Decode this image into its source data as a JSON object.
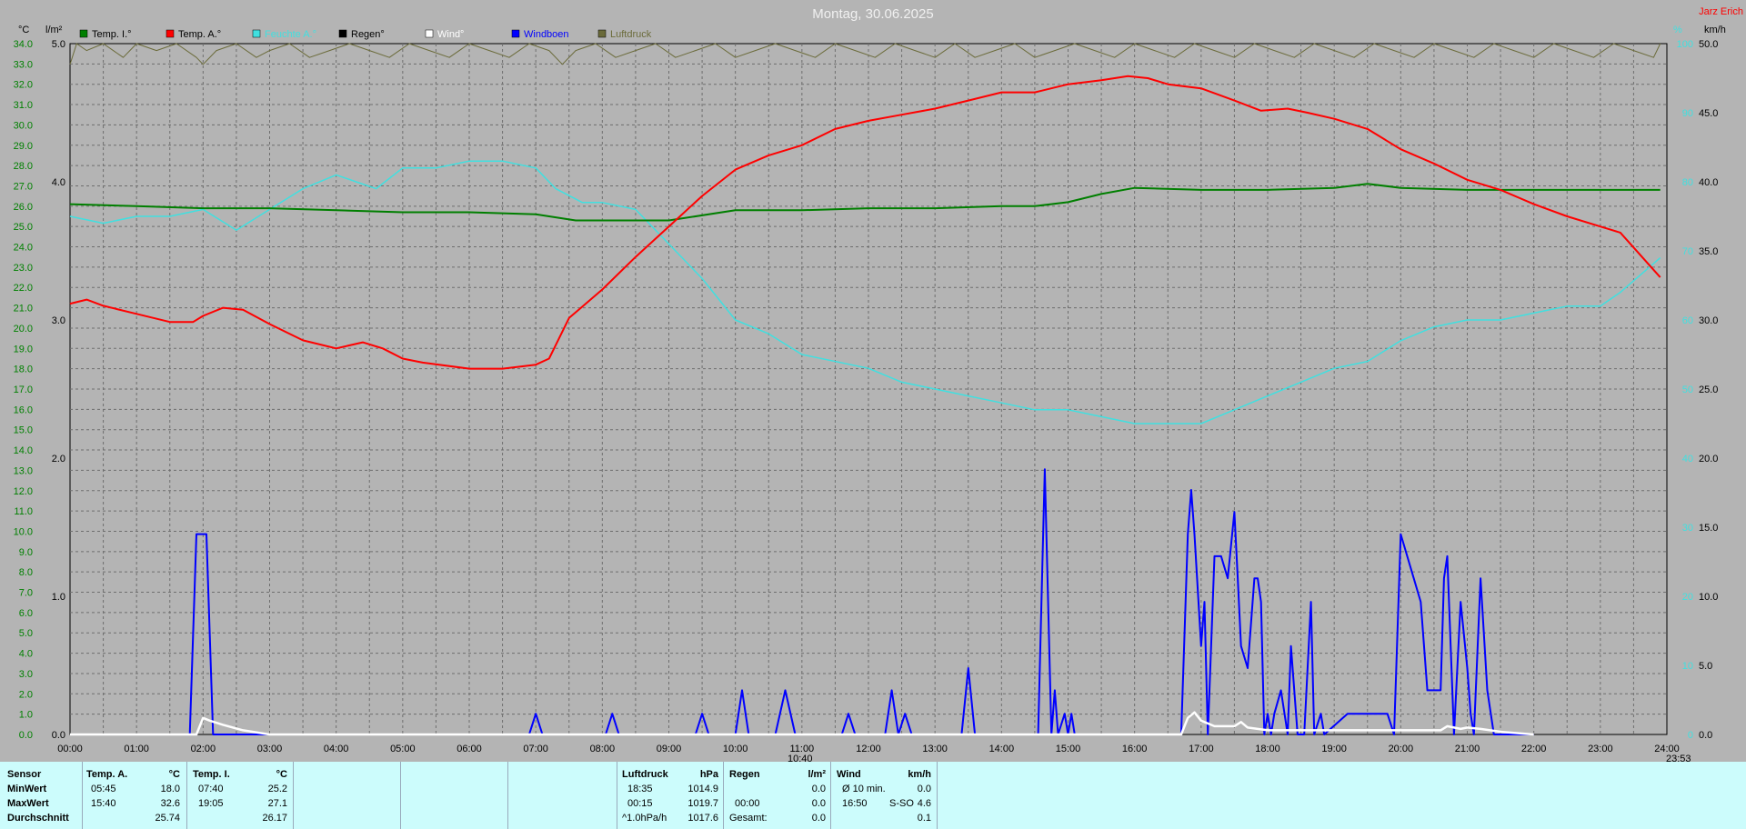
{
  "header": {
    "title": "Montag, 30.06.2025",
    "author": "Jarz Erich",
    "unit_left_temp": "°C",
    "unit_left_rain": "l/m²",
    "unit_right_a": "%",
    "unit_right_b": "km/h"
  },
  "markers": {
    "sunrise": "10:40",
    "sunset": "23:53"
  },
  "chart_data": {
    "type": "line",
    "x_ticks": [
      "00:00",
      "01:00",
      "02:00",
      "03:00",
      "04:00",
      "05:00",
      "06:00",
      "07:00",
      "08:00",
      "09:00",
      "10:00",
      "11:00",
      "12:00",
      "13:00",
      "14:00",
      "15:00",
      "16:00",
      "17:00",
      "18:00",
      "19:00",
      "20:00",
      "21:00",
      "22:00",
      "23:00",
      "24:00"
    ],
    "axes": {
      "temp": {
        "min": 0,
        "max": 34,
        "ticks": [
          "0.0",
          "1.0",
          "2.0",
          "3.0",
          "4.0",
          "5.0",
          "6.0",
          "7.0",
          "8.0",
          "9.0",
          "10.0",
          "11.0",
          "12.0",
          "13.0",
          "14.0",
          "15.0",
          "16.0",
          "17.0",
          "18.0",
          "19.0",
          "20.0",
          "21.0",
          "22.0",
          "23.0",
          "24.0",
          "25.0",
          "26.0",
          "27.0",
          "28.0",
          "29.0",
          "30.0",
          "31.0",
          "32.0",
          "33.0",
          "34.0"
        ]
      },
      "rain": {
        "min": 0,
        "max": 5,
        "ticks": [
          "0.0",
          "1.0",
          "2.0",
          "3.0",
          "4.0",
          "5.0"
        ]
      },
      "humidity": {
        "min": 0,
        "max": 100,
        "ticks": [
          "0",
          "10",
          "20",
          "30",
          "40",
          "50",
          "60",
          "70",
          "80",
          "90",
          "100"
        ]
      },
      "wind": {
        "min": 0,
        "max": 50,
        "ticks": [
          "0.0",
          "5.0",
          "10.0",
          "15.0",
          "20.0",
          "25.0",
          "30.0",
          "35.0",
          "40.0",
          "45.0",
          "50.0"
        ]
      }
    },
    "legend": [
      {
        "name": "Temp. I.°",
        "color": "#007f00"
      },
      {
        "name": "Temp. A.°",
        "color": "#ff0000"
      },
      {
        "name": "Feuchte A.°",
        "color": "#40e0e0"
      },
      {
        "name": "Regen°",
        "color": "#000000"
      },
      {
        "name": "Wind°",
        "color": "#ffffff"
      },
      {
        "name": "Windboen",
        "color": "#0000ff"
      },
      {
        "name": "Luftdruck",
        "color": "#6b6b3a"
      }
    ],
    "series": [
      {
        "name": "Temp. I.°",
        "axis": "temp",
        "color": "#007f00",
        "x": [
          0,
          1,
          2,
          3,
          4,
          5,
          6,
          7,
          7.6,
          9,
          10,
          11,
          12,
          13,
          14,
          14.5,
          15,
          15.5,
          16,
          17,
          18,
          19,
          19.5,
          20,
          21,
          22,
          23,
          23.9
        ],
        "y": [
          26.1,
          26.0,
          25.9,
          25.9,
          25.8,
          25.7,
          25.7,
          25.6,
          25.3,
          25.3,
          25.8,
          25.8,
          25.9,
          25.9,
          26.0,
          26.0,
          26.2,
          26.6,
          26.9,
          26.8,
          26.8,
          26.9,
          27.1,
          26.9,
          26.8,
          26.8,
          26.8,
          26.8
        ]
      },
      {
        "name": "Temp. A.°",
        "axis": "temp",
        "color": "#ff0000",
        "x": [
          0,
          0.25,
          0.5,
          1,
          1.5,
          1.85,
          2,
          2.3,
          2.6,
          3,
          3.5,
          4,
          4.4,
          4.7,
          5,
          5.3,
          6,
          6.5,
          7,
          7.2,
          7.5,
          8,
          8.5,
          9,
          9.5,
          10,
          10.5,
          11,
          11.5,
          12,
          12.5,
          13,
          13.5,
          14,
          14.5,
          15,
          15.5,
          15.9,
          16.2,
          16.5,
          17,
          17.5,
          17.9,
          18.3,
          18.6,
          19,
          19.5,
          20,
          20.5,
          21,
          21.5,
          22,
          22.5,
          23,
          23.3,
          23.9
        ],
        "y": [
          21.2,
          21.4,
          21.1,
          20.7,
          20.3,
          20.3,
          20.6,
          21.0,
          20.9,
          20.2,
          19.4,
          19.0,
          19.3,
          19.0,
          18.5,
          18.3,
          18.0,
          18.0,
          18.2,
          18.5,
          20.5,
          21.9,
          23.5,
          25.0,
          26.5,
          27.8,
          28.5,
          29.0,
          29.8,
          30.2,
          30.5,
          30.8,
          31.2,
          31.6,
          31.6,
          32.0,
          32.2,
          32.4,
          32.3,
          32.0,
          31.8,
          31.2,
          30.7,
          30.8,
          30.6,
          30.3,
          29.8,
          28.8,
          28.1,
          27.3,
          26.8,
          26.1,
          25.5,
          25.0,
          24.7,
          22.5
        ]
      },
      {
        "name": "Feuchte A.°",
        "axis": "humidity",
        "color": "#40e0e0",
        "x": [
          0,
          0.5,
          1,
          1.5,
          2,
          2.5,
          3,
          3.5,
          4,
          4.3,
          4.6,
          5,
          5.5,
          6,
          6.5,
          7,
          7.3,
          7.7,
          8,
          8.5,
          9,
          9.5,
          10,
          10.5,
          11,
          12,
          12.5,
          13,
          13.5,
          14,
          14.5,
          15,
          15.5,
          16,
          16.5,
          17,
          17.5,
          18,
          18.5,
          19,
          19.5,
          20,
          20.5,
          21,
          21.5,
          22,
          22.5,
          23,
          23.3,
          23.9
        ],
        "y": [
          75,
          74,
          75,
          75,
          76,
          73,
          76,
          79,
          81,
          80,
          79,
          82,
          82,
          83,
          83,
          82,
          79,
          77,
          77,
          76,
          71,
          66,
          60,
          58,
          55,
          53,
          51,
          50,
          49,
          48,
          47,
          47,
          46,
          45,
          45,
          45,
          47,
          49,
          51,
          53,
          54,
          57,
          59,
          60,
          60,
          61,
          62,
          62,
          64,
          69
        ]
      },
      {
        "name": "Windboen",
        "axis": "wind",
        "color": "#0000ff",
        "x": [
          0,
          1.8,
          1.9,
          2.05,
          2.15,
          6.9,
          7.0,
          7.1,
          8.05,
          8.15,
          8.25,
          9.4,
          9.5,
          9.6,
          10.0,
          10.1,
          10.2,
          10.6,
          10.75,
          10.9,
          11.6,
          11.7,
          11.8,
          12.25,
          12.35,
          12.45,
          12.55,
          12.65,
          13.4,
          13.5,
          13.6,
          14.55,
          14.65,
          14.75,
          14.8,
          14.85,
          14.95,
          15.0,
          15.05,
          15.1,
          16.7,
          16.8,
          16.85,
          16.9,
          17.0,
          17.05,
          17.1,
          17.2,
          17.3,
          17.4,
          17.5,
          17.55,
          17.6,
          17.7,
          17.8,
          17.85,
          17.9,
          17.95,
          18.0,
          18.05,
          18.1,
          18.2,
          18.3,
          18.35,
          18.45,
          18.55,
          18.65,
          18.7,
          18.8,
          18.85,
          19.2,
          19.3,
          19.4,
          19.7,
          19.8,
          19.9,
          20.0,
          20.3,
          20.4,
          20.6,
          20.65,
          20.7,
          20.8,
          20.9,
          21.0,
          21.05,
          21.1,
          21.2,
          21.3,
          21.4,
          21.5,
          21.6,
          21.65,
          21.7,
          21.8,
          21.85,
          22.0
        ],
        "y": [
          0,
          0,
          14.5,
          14.5,
          0,
          0,
          1.5,
          0,
          0,
          1.5,
          0,
          0,
          1.5,
          0,
          0,
          3.2,
          0,
          0,
          3.2,
          0,
          0,
          1.5,
          0,
          0,
          3.2,
          0,
          1.5,
          0,
          0,
          4.8,
          0,
          0,
          19.2,
          0,
          3.2,
          0,
          1.5,
          0,
          1.5,
          0,
          0,
          14.5,
          17.7,
          14.5,
          6.4,
          9.6,
          0,
          12.9,
          12.9,
          11.3,
          16.1,
          11.3,
          6.4,
          4.8,
          11.3,
          11.3,
          9.6,
          0,
          1.5,
          0,
          1.5,
          3.2,
          0,
          6.4,
          0,
          0,
          9.6,
          0,
          1.5,
          0,
          1.5,
          1.5,
          1.5,
          1.5,
          1.5,
          0,
          14.5,
          9.6,
          3.2,
          3.2,
          11.3,
          12.9,
          0,
          9.6,
          4.8,
          1.5,
          0,
          11.3,
          3.2,
          0,
          0,
          0,
          0,
          0,
          0,
          0,
          0
        ]
      },
      {
        "name": "Wind°",
        "axis": "wind",
        "color": "#ffffff",
        "x": [
          0,
          1.9,
          2.0,
          2.1,
          2.3,
          2.6,
          3,
          16.7,
          16.8,
          16.9,
          17.0,
          17.2,
          17.5,
          17.6,
          17.7,
          18,
          20.6,
          20.7,
          20.9,
          21.0,
          21.2,
          21.5,
          22
        ],
        "y": [
          0,
          0,
          1.2,
          1.0,
          0.7,
          0.3,
          0,
          0,
          1.2,
          1.6,
          1.0,
          0.6,
          0.6,
          0.9,
          0.5,
          0.3,
          0.3,
          0.6,
          0.4,
          0.5,
          0.4,
          0.2,
          0
        ]
      },
      {
        "name": "Luftdruck",
        "axis": "humidity",
        "color": "#6b6b3a",
        "x": [
          0,
          0.1,
          0.25,
          0.5,
          0.8,
          1.0,
          1.3,
          1.6,
          1.9,
          2.0,
          2.2,
          2.5,
          2.8,
          3.0,
          3.3,
          3.6,
          3.9,
          4.2,
          4.5,
          4.8,
          5.1,
          5.4,
          5.7,
          6.0,
          6.3,
          6.6,
          6.9,
          7.2,
          7.4,
          7.6,
          7.9,
          8.2,
          8.5,
          8.8,
          9.1,
          9.4,
          9.7,
          10.0,
          10.3,
          10.6,
          10.9,
          11.2,
          11.5,
          11.8,
          12.1,
          12.4,
          12.7,
          13.0,
          13.3,
          13.6,
          13.9,
          14.2,
          14.5,
          14.8,
          15.1,
          15.4,
          15.7,
          16.0,
          16.3,
          16.6,
          16.9,
          17.2,
          17.5,
          17.8,
          18.1,
          18.4,
          18.7,
          19.0,
          19.3,
          19.6,
          19.9,
          20.2,
          20.5,
          20.8,
          21.1,
          21.4,
          21.7,
          22.0,
          22.3,
          22.6,
          22.9,
          23.2,
          23.5,
          23.8,
          23.9
        ],
        "y": [
          97,
          100,
          99,
          100,
          98,
          100,
          99,
          100,
          98,
          97,
          99,
          100,
          98,
          99,
          100,
          98,
          99,
          100,
          99,
          98,
          100,
          99,
          98,
          100,
          99,
          98,
          100,
          99,
          97,
          99,
          100,
          98,
          99,
          100,
          98,
          99,
          100,
          98,
          99,
          100,
          99,
          98,
          100,
          99,
          98,
          100,
          99,
          98,
          100,
          98,
          99,
          100,
          98,
          99,
          100,
          99,
          98,
          100,
          99,
          98,
          100,
          99,
          98,
          100,
          99,
          98,
          100,
          99,
          98,
          100,
          99,
          98,
          100,
          99,
          98,
          100,
          99,
          98,
          100,
          99,
          98,
          100,
          99,
          98,
          100
        ]
      }
    ]
  },
  "stats": {
    "sensor_label": "Sensor",
    "rows": [
      "MinWert",
      "MaxWert",
      "Durchschnitt"
    ],
    "temp_a": {
      "label": "Temp. A.",
      "unit": "°C",
      "min_time": "05:45",
      "min": "18.0",
      "max_time": "15:40",
      "max": "32.6",
      "avg": "25.74"
    },
    "temp_i": {
      "label": "Temp. I.",
      "unit": "°C",
      "min_time": "07:40",
      "min": "25.2",
      "max_time": "19:05",
      "max": "27.1",
      "avg": "26.17"
    },
    "pressure": {
      "label": "Luftdruck",
      "unit": "hPa",
      "r1_time": "18:35",
      "r1_val": "1014.9",
      "r2_time": "00:15",
      "r2_val": "1019.7",
      "r3_label": "^1.0hPa/h",
      "r3_val": "1017.6"
    },
    "rain": {
      "label": "Regen",
      "unit": "l/m²",
      "r2_time": "00:00",
      "r2_val": "0.0",
      "r1_val": "0.0",
      "r3_label": "Gesamt:",
      "r3_val": "0.0"
    },
    "wind": {
      "label": "Wind",
      "unit": "km/h",
      "r1_label": "Ø 10 min.",
      "r1_val": "0.0",
      "r2_time": "16:50",
      "r2_dir": "S-SO",
      "r2_val": "4.6",
      "r3_val": "0.1"
    }
  }
}
